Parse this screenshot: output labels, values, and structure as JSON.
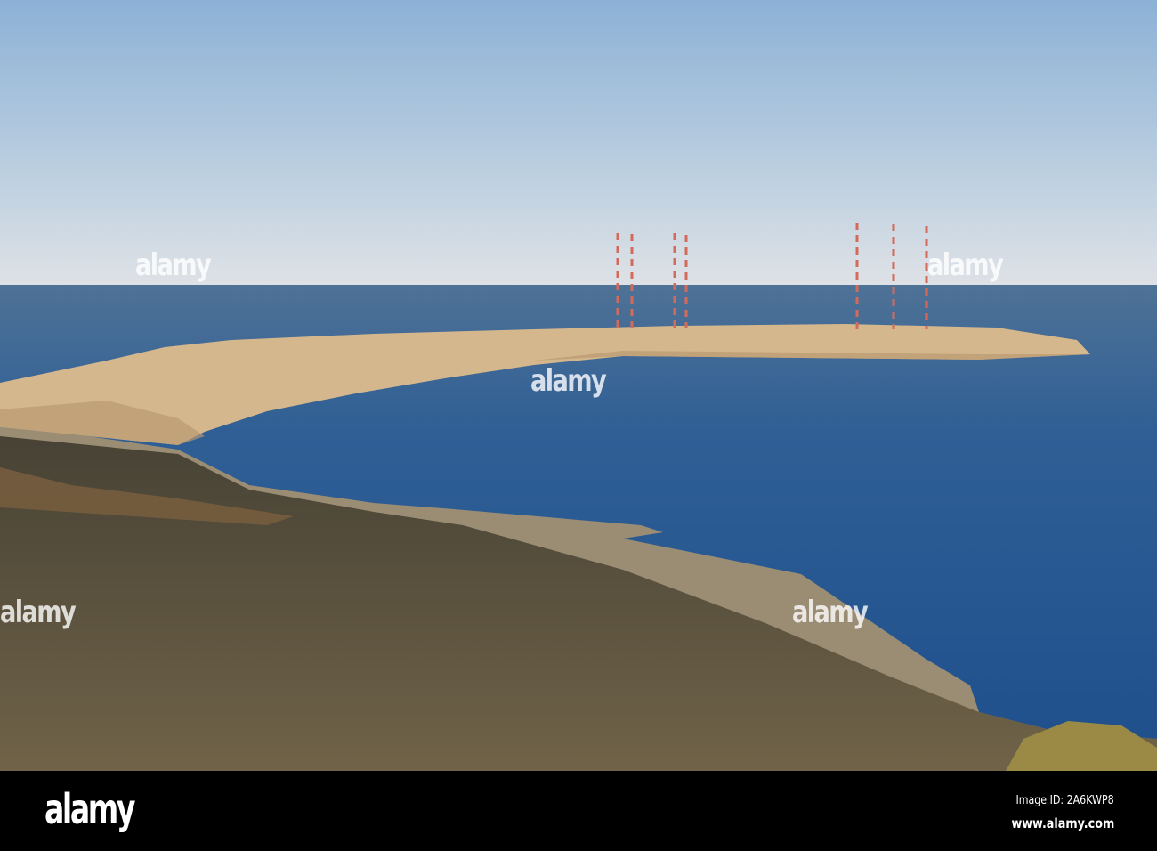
{
  "image": {
    "subject": "Coastal peninsula with red-and-white radio masts",
    "colors": {
      "sky_top": "#8fb3d6",
      "sky_horizon": "#d8dfe6",
      "sea": "#2f5f95",
      "land_lit": "#d8b98e",
      "land_shadow": "#4a4433"
    }
  },
  "watermark": {
    "text": "alamy"
  },
  "footer": {
    "logo": "alamy",
    "image_id": "Image ID: 2A6KWP8",
    "website": "www.alamy.com"
  }
}
